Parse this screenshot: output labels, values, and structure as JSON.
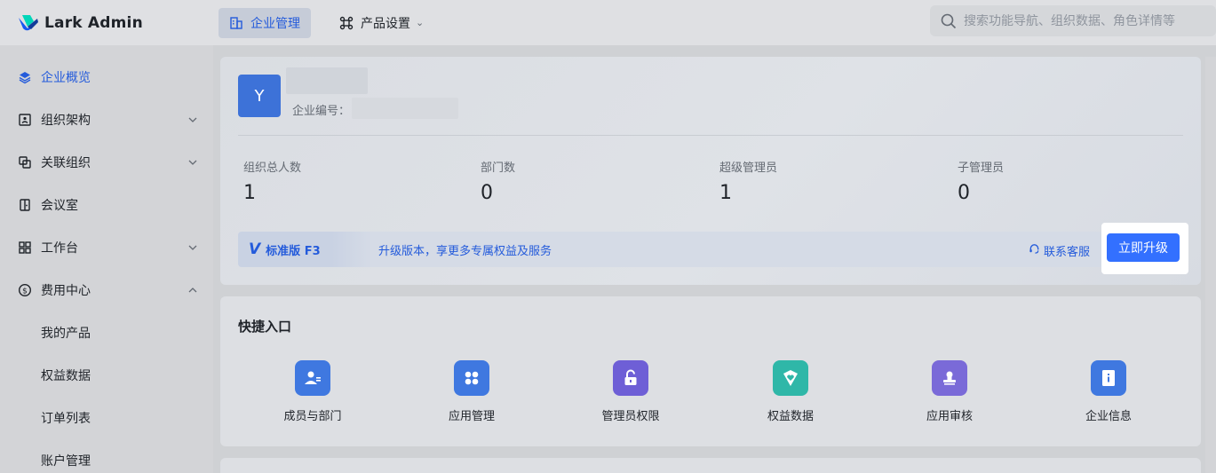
{
  "app": {
    "name": "Lark Admin"
  },
  "header": {
    "tabs": [
      {
        "label": "企业管理",
        "icon": "building-icon",
        "active": true
      },
      {
        "label": "产品设置",
        "icon": "product-settings-icon",
        "active": false
      }
    ],
    "search": {
      "placeholder": "搜索功能导航、组织数据、角色详情等"
    }
  },
  "sidebar": {
    "items": [
      {
        "label": "企业概览",
        "icon": "layers-icon",
        "active": true
      },
      {
        "label": "组织架构",
        "icon": "org-chart-icon",
        "expandable": true
      },
      {
        "label": "关联组织",
        "icon": "linked-org-icon",
        "expandable": true
      },
      {
        "label": "会议室",
        "icon": "door-icon"
      },
      {
        "label": "工作台",
        "icon": "grid-icon",
        "expandable": true
      },
      {
        "label": "费用中心",
        "icon": "dollar-icon",
        "expandable": true,
        "expanded": true
      },
      {
        "label": "我的产品",
        "sub": true
      },
      {
        "label": "权益数据",
        "sub": true
      },
      {
        "label": "订单列表",
        "sub": true
      },
      {
        "label": "账户管理",
        "sub": true
      }
    ]
  },
  "overview": {
    "avatar_letter": "Y",
    "enterprise_id_label": "企业编号：",
    "stats": [
      {
        "name": "组织总人数",
        "value": "1"
      },
      {
        "name": "部门数",
        "value": "0"
      },
      {
        "name": "超级管理员",
        "value": "1"
      },
      {
        "name": "子管理员",
        "value": "0"
      }
    ],
    "plan": {
      "badge": "标准版 F3",
      "text": "升级版本，享更多专属权益及服务",
      "contact_label": "联系客服",
      "upgrade_label": "立即升级"
    }
  },
  "quick": {
    "title": "快捷入口",
    "items": [
      {
        "label": "成员与部门",
        "icon": "members-icon",
        "color": "#3f78e0"
      },
      {
        "label": "应用管理",
        "icon": "apps-icon",
        "color": "#3f78e0"
      },
      {
        "label": "管理员权限",
        "icon": "unlock-icon",
        "color": "#6e5fd6"
      },
      {
        "label": "权益数据",
        "icon": "heart-badge-icon",
        "color": "#2fb7a8"
      },
      {
        "label": "应用审核",
        "icon": "audit-icon",
        "color": "#7a6ad8"
      },
      {
        "label": "企业信息",
        "icon": "info-book-icon",
        "color": "#3f78e0"
      }
    ]
  }
}
